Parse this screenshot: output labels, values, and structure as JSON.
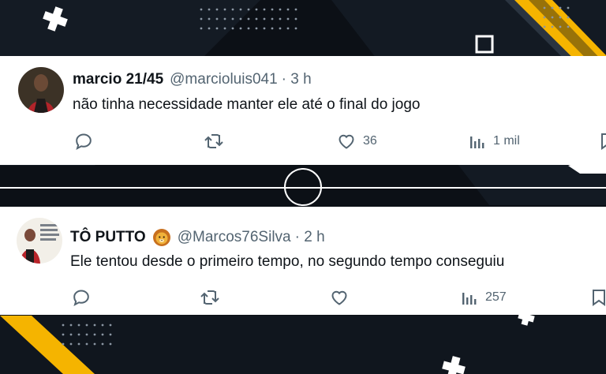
{
  "tweets": [
    {
      "name": "marcio 21/45",
      "handle": "@marcioluis041",
      "time": "· 3 h",
      "text": "não tinha necessidade manter ele até o final do jogo",
      "likes": "36",
      "views": "1 mil",
      "avatar": "avatar-photo"
    },
    {
      "name": "TÔ PUTTO",
      "handle": "@Marcos76Silva",
      "time": "· 2 h",
      "text": "Ele tentou desde o primeiro tempo, no segundo tempo conseguiu",
      "likes": "",
      "views": "257",
      "avatar": "avatar-meme",
      "name_emoji": "lion-face-emoji"
    }
  ],
  "icons": [
    "reply-icon",
    "retweet-icon",
    "like-icon",
    "views-icon",
    "bookmark-icon"
  ],
  "colors": {
    "background": "#0c1016",
    "accent_yellow": "#f5b400",
    "card": "#ffffff",
    "text_primary": "#0f1419",
    "text_secondary": "#536471"
  }
}
